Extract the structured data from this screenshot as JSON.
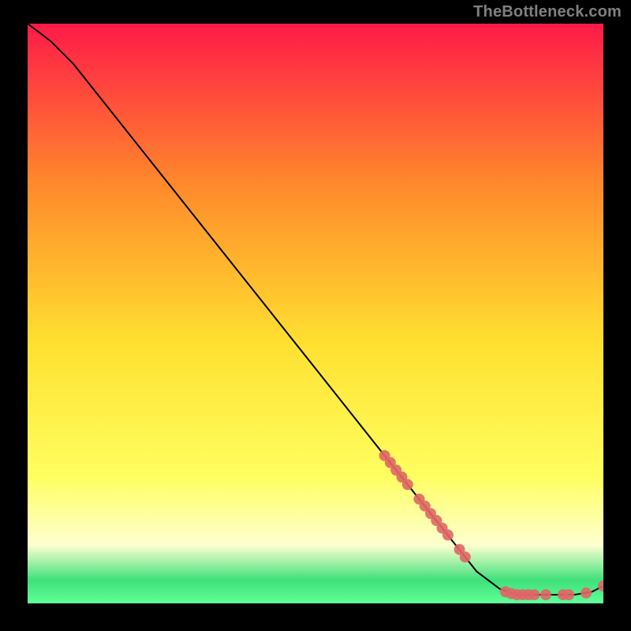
{
  "attribution": "TheBottleneck.com",
  "colors": {
    "bg": "#000000",
    "attribution_text": "#808080",
    "curve_stroke": "#000000",
    "marker_fill": "#e06666",
    "gradient_top": "#ff1a48",
    "gradient_mid_upper": "#ff8a2b",
    "gradient_mid": "#ffe030",
    "gradient_mid_lower": "#ffff60",
    "gradient_lower": "#fdffd0",
    "gradient_green": "#3fe07a",
    "gradient_bottom": "#5fff9a"
  },
  "chart_data": {
    "type": "line",
    "title": "",
    "xlabel": "",
    "ylabel": "",
    "xlim": [
      0,
      100
    ],
    "ylim": [
      0,
      100
    ],
    "curve": [
      {
        "x": 0,
        "y": 100
      },
      {
        "x": 4,
        "y": 97
      },
      {
        "x": 8,
        "y": 93
      },
      {
        "x": 12,
        "y": 88
      },
      {
        "x": 20,
        "y": 78
      },
      {
        "x": 30,
        "y": 65.5
      },
      {
        "x": 40,
        "y": 53
      },
      {
        "x": 50,
        "y": 40.5
      },
      {
        "x": 60,
        "y": 28
      },
      {
        "x": 70,
        "y": 15.5
      },
      {
        "x": 78,
        "y": 5.5
      },
      {
        "x": 82,
        "y": 2.5
      },
      {
        "x": 85,
        "y": 1.5
      },
      {
        "x": 90,
        "y": 1.5
      },
      {
        "x": 95,
        "y": 1.5
      },
      {
        "x": 98,
        "y": 2.0
      },
      {
        "x": 100,
        "y": 3.0
      }
    ],
    "markers": [
      {
        "x": 62,
        "y": 25.5
      },
      {
        "x": 63,
        "y": 24.3
      },
      {
        "x": 64,
        "y": 23.0
      },
      {
        "x": 65,
        "y": 21.8
      },
      {
        "x": 66,
        "y": 20.5
      },
      {
        "x": 68,
        "y": 18.0
      },
      {
        "x": 69,
        "y": 16.8
      },
      {
        "x": 70,
        "y": 15.5
      },
      {
        "x": 71,
        "y": 14.3
      },
      {
        "x": 72,
        "y": 13.0
      },
      {
        "x": 73,
        "y": 11.8
      },
      {
        "x": 75,
        "y": 9.3
      },
      {
        "x": 76,
        "y": 8.0
      },
      {
        "x": 83,
        "y": 2.0
      },
      {
        "x": 84,
        "y": 1.7
      },
      {
        "x": 85,
        "y": 1.5
      },
      {
        "x": 86,
        "y": 1.5
      },
      {
        "x": 87,
        "y": 1.5
      },
      {
        "x": 88,
        "y": 1.5
      },
      {
        "x": 90,
        "y": 1.5
      },
      {
        "x": 93,
        "y": 1.5
      },
      {
        "x": 94,
        "y": 1.5
      },
      {
        "x": 97,
        "y": 1.8
      },
      {
        "x": 100,
        "y": 3.0
      }
    ]
  }
}
